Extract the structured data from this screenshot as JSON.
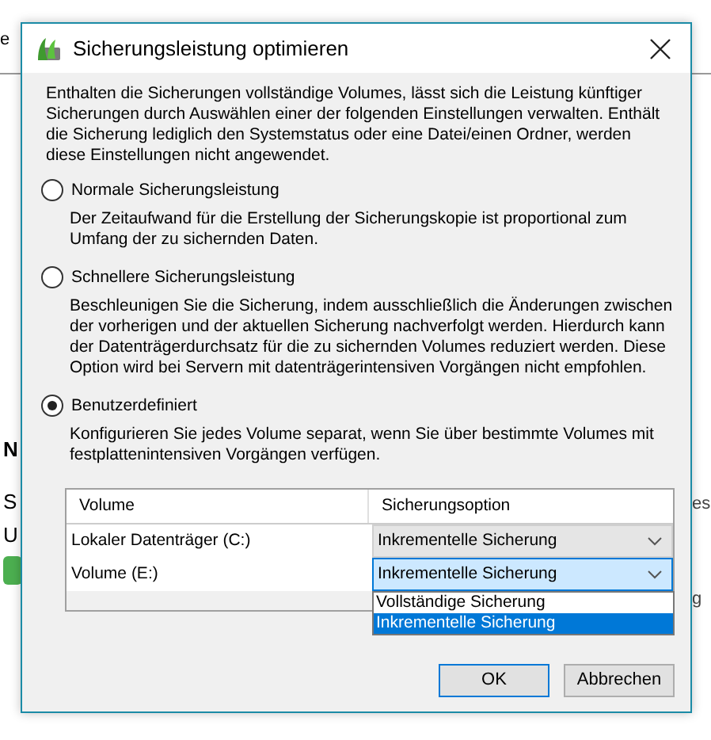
{
  "background_window": {
    "title_fragment": "e",
    "left_labels": [
      "N",
      "S",
      "U"
    ],
    "right_labels": [
      "es",
      "g"
    ]
  },
  "dialog": {
    "title": "Sicherungsleistung optimieren",
    "intro": "Enthalten die Sicherungen vollständige Volumes, lässt sich die Leistung künftiger Sicherungen durch Auswählen einer der folgenden Einstellungen verwalten. Enthält die Sicherung lediglich den Systemstatus oder eine Datei/einen Ordner, werden diese Einstellungen nicht angewendet.",
    "options": [
      {
        "label": "Normale Sicherungsleistung",
        "selected": false,
        "description": "Der Zeitaufwand für die Erstellung der Sicherungskopie ist proportional zum Umfang der zu sichernden Daten."
      },
      {
        "label": "Schnellere Sicherungsleistung",
        "selected": false,
        "description": "Beschleunigen Sie die Sicherung, indem ausschließlich die Änderungen zwischen der vorherigen und der aktuellen Sicherung nachverfolgt werden. Hierdurch kann der Datenträgerdurchsatz für die zu sichernden Volumes reduziert werden. Diese Option wird bei Servern mit datenträgerintensiven Vorgängen nicht empfohlen."
      },
      {
        "label": "Benutzerdefiniert",
        "selected": true,
        "description": "Konfigurieren Sie jedes Volume separat, wenn Sie über bestimmte Volumes mit festplattenintensiven Vorgängen verfügen."
      }
    ],
    "table": {
      "columns": [
        "Volume",
        "Sicherungsoption"
      ],
      "rows": [
        {
          "volume": "Lokaler Datenträger (C:)",
          "option": "Inkrementelle Sicherung",
          "open": false
        },
        {
          "volume": "Volume (E:)",
          "option": "Inkrementelle Sicherung",
          "open": true,
          "dropdown_items": [
            {
              "label": "Vollständige Sicherung",
              "selected": false
            },
            {
              "label": "Inkrementelle Sicherung",
              "selected": true
            }
          ]
        }
      ]
    },
    "buttons": [
      "OK",
      "Abbrechen"
    ]
  }
}
